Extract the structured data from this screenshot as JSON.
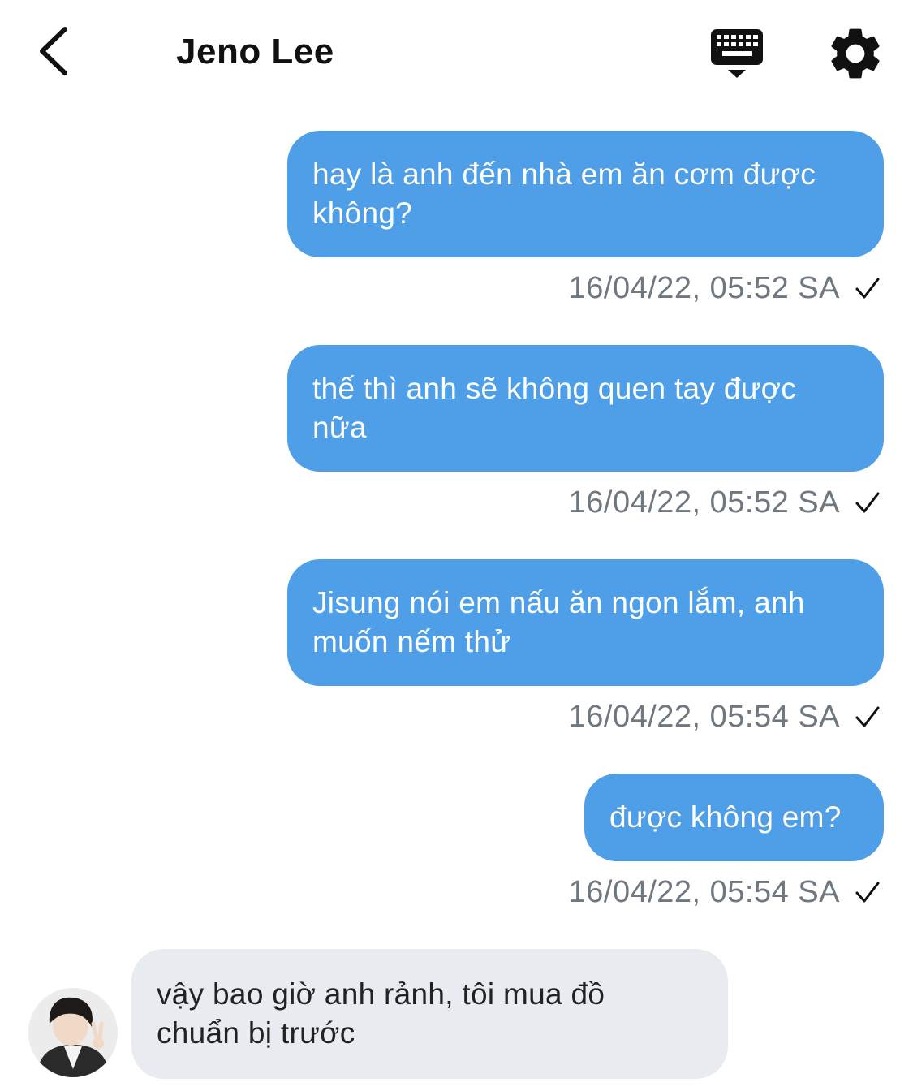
{
  "header": {
    "title": "Jeno Lee"
  },
  "icons": {
    "back": "chevron-left-icon",
    "keyboard": "keyboard-icon",
    "settings": "gear-icon",
    "read_status": "check-icon"
  },
  "colors": {
    "outgoing_bubble": "#4f9ee8",
    "incoming_bubble": "#e8ebef",
    "timestamp": "#6f7781"
  },
  "messages": [
    {
      "direction": "outgoing",
      "lines": [
        "hay là anh đến nhà em ăn cơm được",
        "không?"
      ],
      "timestamp": "16/04/22, 05:52 SA",
      "read": true
    },
    {
      "direction": "outgoing",
      "lines": [
        "thế thì anh sẽ không quen tay được",
        "nữa"
      ],
      "timestamp": "16/04/22, 05:52 SA",
      "read": true
    },
    {
      "direction": "outgoing",
      "lines": [
        "Jisung nói em nấu ăn ngon lắm, anh",
        "muốn nếm thử"
      ],
      "timestamp": "16/04/22, 05:54 SA",
      "read": true
    },
    {
      "direction": "outgoing",
      "lines": [
        "được không em?"
      ],
      "timestamp": "16/04/22, 05:54 SA",
      "read": true
    },
    {
      "direction": "incoming",
      "lines": [
        "vậy bao giờ anh rảnh, tôi mua đồ",
        "chuẩn bị trước"
      ]
    }
  ]
}
